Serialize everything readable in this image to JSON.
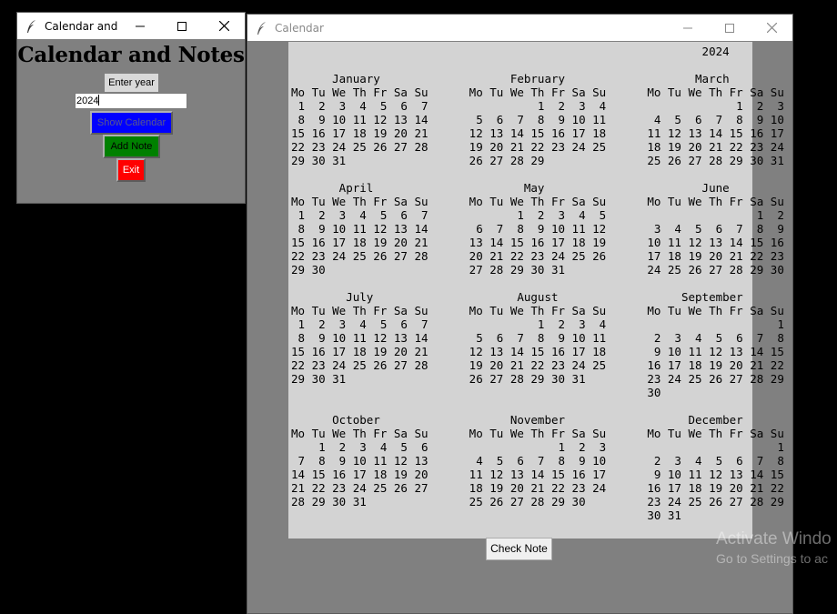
{
  "small_window": {
    "title": "Calendar and ...",
    "heading": "Calendar and Notes",
    "year_label": "Enter year",
    "year_value": "2024",
    "show_calendar_label": "Show Calendar",
    "add_note_label": "Add Note",
    "exit_label": "Exit"
  },
  "calendar_window": {
    "title": "Calendar",
    "calendar_text": "                                                            2024\n\n      January                   February                   March\nMo Tu We Th Fr Sa Su      Mo Tu We Th Fr Sa Su      Mo Tu We Th Fr Sa Su\n 1  2  3  4  5  6  7                1  2  3  4                   1  2  3\n 8  9 10 11 12 13 14       5  6  7  8  9 10 11       4  5  6  7  8  9 10\n15 16 17 18 19 20 21      12 13 14 15 16 17 18      11 12 13 14 15 16 17\n22 23 24 25 26 27 28      19 20 21 22 23 24 25      18 19 20 21 22 23 24\n29 30 31                  26 27 28 29               25 26 27 28 29 30 31\n\n       April                      May                       June\nMo Tu We Th Fr Sa Su      Mo Tu We Th Fr Sa Su      Mo Tu We Th Fr Sa Su\n 1  2  3  4  5  6  7             1  2  3  4  5                      1  2\n 8  9 10 11 12 13 14       6  7  8  9 10 11 12       3  4  5  6  7  8  9\n15 16 17 18 19 20 21      13 14 15 16 17 18 19      10 11 12 13 14 15 16\n22 23 24 25 26 27 28      20 21 22 23 24 25 26      17 18 19 20 21 22 23\n29 30                     27 28 29 30 31            24 25 26 27 28 29 30\n\n        July                     August                  September\nMo Tu We Th Fr Sa Su      Mo Tu We Th Fr Sa Su      Mo Tu We Th Fr Sa Su\n 1  2  3  4  5  6  7                1  2  3  4                         1\n 8  9 10 11 12 13 14       5  6  7  8  9 10 11       2  3  4  5  6  7  8\n15 16 17 18 19 20 21      12 13 14 15 16 17 18       9 10 11 12 13 14 15\n22 23 24 25 26 27 28      19 20 21 22 23 24 25      16 17 18 19 20 21 22\n29 30 31                  26 27 28 29 30 31         23 24 25 26 27 28 29\n                                                    30\n\n      October                   November                  December\nMo Tu We Th Fr Sa Su      Mo Tu We Th Fr Sa Su      Mo Tu We Th Fr Sa Su\n    1  2  3  4  5  6                   1  2  3                         1\n 7  8  9 10 11 12 13       4  5  6  7  8  9 10       2  3  4  5  6  7  8\n14 15 16 17 18 19 20      11 12 13 14 15 16 17       9 10 11 12 13 14 15\n21 22 23 24 25 26 27      18 19 20 21 22 23 24      16 17 18 19 20 21 22\n28 29 30 31               25 26 27 28 29 30         23 24 25 26 27 28 29\n                                                    30 31",
    "check_note_label": "Check Note"
  },
  "watermark": {
    "line1": "Activate Windo",
    "line2": "Go to Settings to ac"
  },
  "colors": {
    "show_button": "#0000ff",
    "add_button": "#008000",
    "exit_button": "#ff0000",
    "window_bg": "#808080",
    "calendar_bg": "#d3d3d3"
  },
  "icons": [
    "feather-icon",
    "minimize-icon",
    "maximize-icon",
    "close-icon"
  ]
}
